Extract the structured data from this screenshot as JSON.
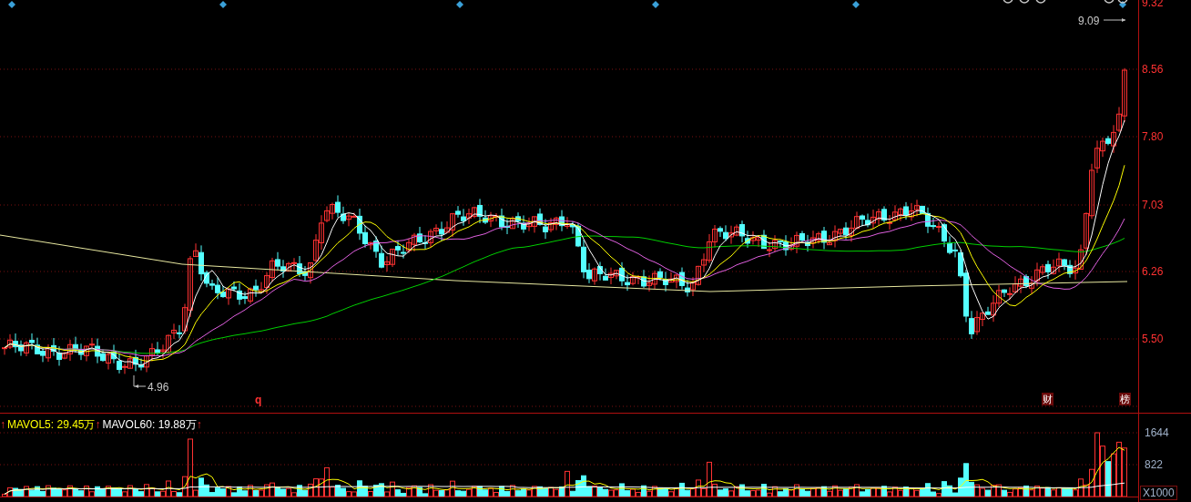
{
  "price_axis": {
    "ticks": [
      "9.32",
      "8.56",
      "7.80",
      "7.03",
      "6.26",
      "5.50"
    ]
  },
  "markers": {
    "high_label": "9.09",
    "low_label": "4.96"
  },
  "badges": [
    {
      "text": "q",
      "kind": "plain"
    },
    {
      "text": "财",
      "kind": "boxed"
    },
    {
      "text": "榜",
      "kind": "boxed"
    }
  ],
  "volume": {
    "legend": [
      {
        "arrow": "↑",
        "label": "MAVOL5: 29.45万",
        "color": "#ffff00"
      },
      {
        "arrow": "↑",
        "label": "MAVOL60: 19.88万",
        "color": "#ffffff"
      }
    ],
    "trailing_arrow": "↑",
    "ticks": [
      "1644",
      "822"
    ],
    "unit": "X1000"
  }
}
